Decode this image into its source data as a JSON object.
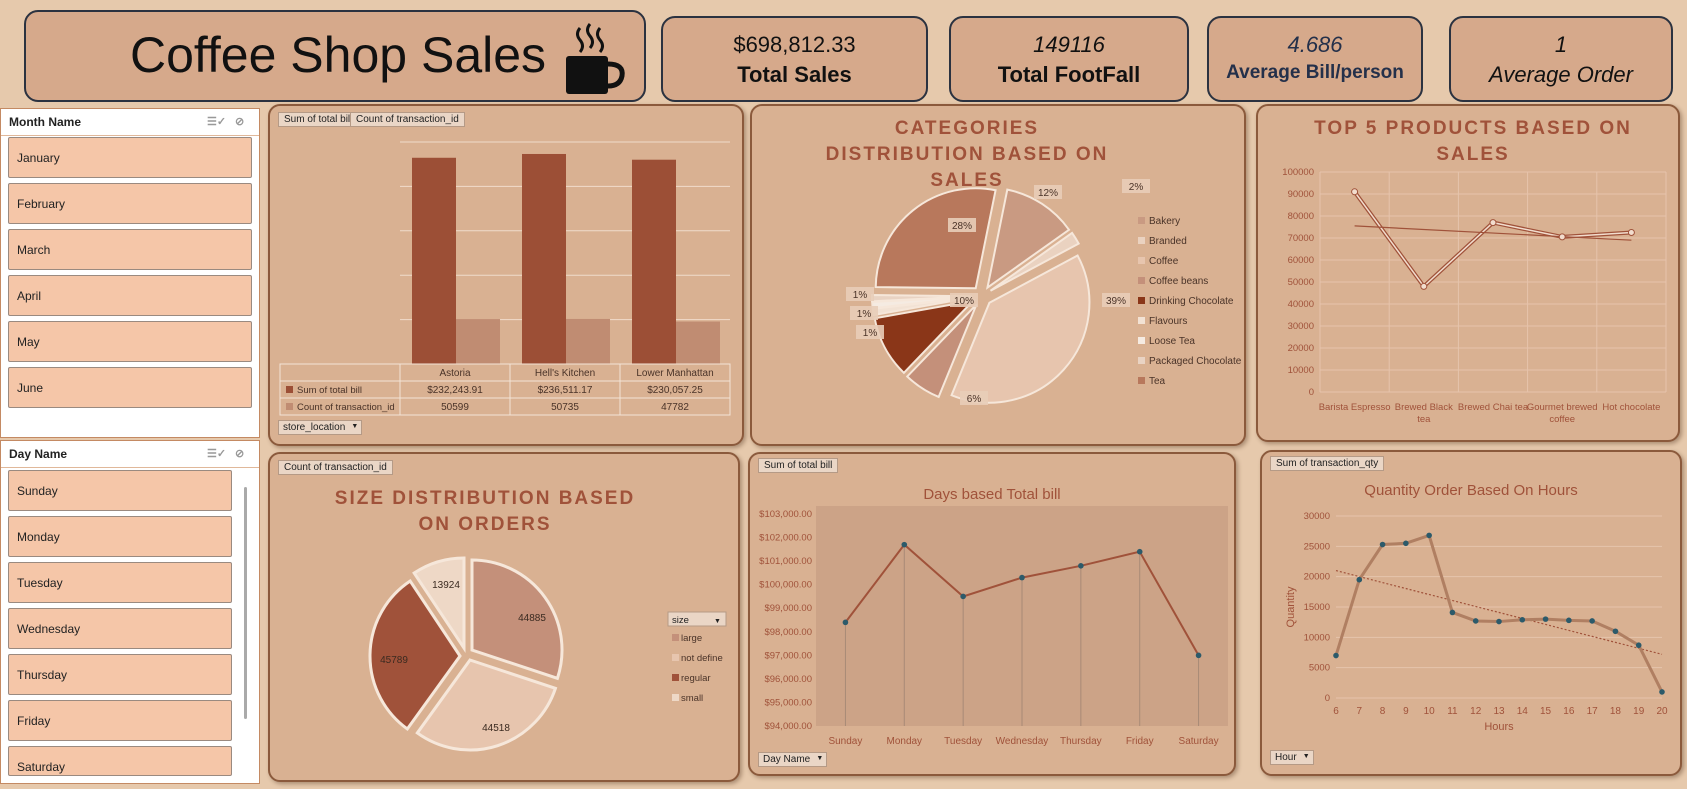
{
  "header": {
    "title": "Coffee Shop Sales",
    "icon": "coffee-cup-icon"
  },
  "kpis": [
    {
      "value": "$698,812.33",
      "label": "Total Sales"
    },
    {
      "value": "149116",
      "label": "Total FootFall"
    },
    {
      "value": "4.686",
      "label": "Average Bill/person"
    },
    {
      "value": "1",
      "label": "Average Order"
    }
  ],
  "month_slicer": {
    "title": "Month Name",
    "items": [
      "January",
      "February",
      "March",
      "April",
      "May",
      "June"
    ]
  },
  "day_slicer": {
    "title": "Day Name",
    "items": [
      "Sunday",
      "Monday",
      "Tuesday",
      "Wednesday",
      "Thursday",
      "Friday",
      "Saturday"
    ]
  },
  "store_chart": {
    "buttons": [
      "Sum of total bill",
      "Count of transaction_id"
    ],
    "dropdown": "store_location",
    "table_rows": [
      {
        "label": "Sum of total bill",
        "values": [
          "$232,243.91",
          "$236,511.17",
          "$230,057.25"
        ]
      },
      {
        "label": "Count of transaction_id",
        "values": [
          "50599",
          "50735",
          "47782"
        ]
      }
    ]
  },
  "category_chart": {
    "title": "CATEGORIES DISTRIBUTION BASED ON SALES",
    "labels": [
      "28%",
      "12%",
      "2%",
      "39%",
      "10%",
      "6%",
      "1%",
      "1%",
      "1%"
    ],
    "legend": [
      "Bakery",
      "Branded",
      "Coffee",
      "Coffee beans",
      "Drinking Chocolate",
      "Flavours",
      "Loose Tea",
      "Packaged Chocolate",
      "Tea"
    ]
  },
  "top5_chart": {
    "title": "TOP 5 PRODUCTS BASED ON SALES",
    "yticks": [
      "100000",
      "90000",
      "80000",
      "70000",
      "60000",
      "50000",
      "40000",
      "30000",
      "20000",
      "10000",
      "0"
    ],
    "xlabels": [
      [
        "Barista Espresso"
      ],
      [
        "Brewed Black",
        "tea"
      ],
      [
        "Brewed Chai tea"
      ],
      [
        "Gourmet brewed",
        "coffee"
      ],
      [
        "Hot chocolate"
      ]
    ]
  },
  "size_chart": {
    "button": "Count of transaction_id",
    "title": "SIZE DISTRIBUTION BASED ON ORDERS",
    "labels": [
      "13924",
      "44885",
      "44518",
      "45789"
    ],
    "legend_title": "size",
    "legend": [
      "large",
      "not define",
      "regular",
      "small"
    ]
  },
  "days_chart": {
    "button": "Sum of total bill",
    "title": "Days based Total bill",
    "dropdown": "Day Name",
    "yticks": [
      "$103,000.00",
      "$102,000.00",
      "$101,000.00",
      "$100,000.00",
      "$99,000.00",
      "$98,000.00",
      "$97,000.00",
      "$96,000.00",
      "$95,000.00",
      "$94,000.00"
    ],
    "xlabels": [
      "Sunday",
      "Monday",
      "Tuesday",
      "Wednesday",
      "Thursday",
      "Friday",
      "Saturday"
    ]
  },
  "hours_chart": {
    "button": "Sum of transaction_qty",
    "title": "Quantity Order Based On Hours",
    "ylabel": "Quantity",
    "xlabel": "Hours",
    "dropdown": "Hour",
    "yticks": [
      "30000",
      "25000",
      "20000",
      "15000",
      "10000",
      "5000",
      "0"
    ],
    "xticks": [
      "6",
      "7",
      "8",
      "9",
      "10",
      "11",
      "12",
      "13",
      "14",
      "15",
      "16",
      "17",
      "18",
      "19",
      "20"
    ]
  },
  "chart_data": [
    {
      "type": "bar",
      "categories": [
        "Astoria",
        "Hell's Kitchen",
        "Lower Manhattan"
      ],
      "series": [
        {
          "name": "Sum of total bill",
          "values": [
            232243.91,
            236511.17,
            230057.25
          ],
          "color": "#9c4f36"
        },
        {
          "name": "Count of transaction_id",
          "values": [
            50599,
            50735,
            47782
          ],
          "color": "#c08c72"
        }
      ],
      "ylim": [
        0,
        250000
      ]
    },
    {
      "type": "pie",
      "title": "CATEGORIES DISTRIBUTION BASED ON SALES",
      "labels": [
        "Bakery",
        "Branded",
        "Coffee",
        "Coffee beans",
        "Drinking Chocolate",
        "Flavours",
        "Loose Tea",
        "Packaged Chocolate",
        "Tea"
      ],
      "values": [
        12,
        2,
        39,
        6,
        10,
        1,
        1,
        1,
        28
      ]
    },
    {
      "type": "line",
      "title": "TOP 5 PRODUCTS BASED ON SALES",
      "categories": [
        "Barista Espresso",
        "Brewed Black tea",
        "Brewed Chai tea",
        "Gourmet brewed coffee",
        "Hot chocolate"
      ],
      "values": [
        91000,
        48000,
        77000,
        70500,
        72500
      ],
      "ylim": [
        0,
        100000
      ]
    },
    {
      "type": "pie",
      "title": "SIZE DISTRIBUTION BASED ON ORDERS",
      "labels": [
        "large",
        "not define",
        "regular",
        "small"
      ],
      "values": [
        44885,
        44518,
        45789,
        13924
      ]
    },
    {
      "type": "line",
      "title": "Days based Total bill",
      "categories": [
        "Sunday",
        "Monday",
        "Tuesday",
        "Wednesday",
        "Thursday",
        "Friday",
        "Saturday"
      ],
      "values": [
        98400,
        101700,
        99500,
        100300,
        100800,
        101400,
        97000
      ],
      "ylim": [
        94000,
        103000
      ]
    },
    {
      "type": "line",
      "title": "Quantity Order Based On Hours",
      "xlabel": "Hours",
      "ylabel": "Quantity",
      "x": [
        6,
        7,
        8,
        9,
        10,
        11,
        12,
        13,
        14,
        15,
        16,
        17,
        18,
        19,
        20
      ],
      "values": [
        7000,
        19500,
        25300,
        25500,
        26800,
        14100,
        12700,
        12600,
        12900,
        13000,
        12800,
        12700,
        11000,
        8700,
        1000
      ],
      "ylim": [
        0,
        30000
      ]
    }
  ]
}
